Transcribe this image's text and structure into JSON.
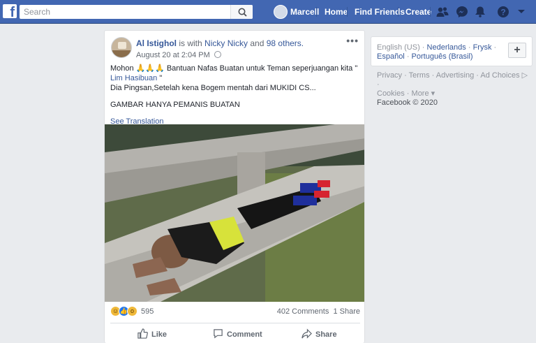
{
  "topbar": {
    "logo": "f",
    "search_placeholder": "Search",
    "user_name": "Marcell",
    "links": [
      "Home",
      "Find Friends",
      "Create"
    ],
    "icons": [
      "friends-icon",
      "messenger-icon",
      "notifications-icon",
      "help-icon",
      "account-menu-icon"
    ],
    "accent": "#4267b2"
  },
  "post": {
    "author": "Al Istighol",
    "with_text": "is with",
    "tagged": "Nicky Nicky",
    "and_text": "and",
    "others": "98 others.",
    "timestamp": "August 20 at 2:04 PM",
    "menu": "•••",
    "line1": "Mohon 🙏🙏🙏 Bantuan Nafas Buatan untuk Teman seperjuangan kita \"",
    "mention": "Lim Hasibuan",
    "mention_close": " \"",
    "line3": "Dia Pingsan,Setelah kena Bogem mentah dari MUKIDI CS...",
    "line4": "GAMBAR HANYA PEMANIS BUATAN",
    "see_translation": "See Translation",
    "reaction_count": "595",
    "comments": "402 Comments",
    "shares": "1 Share",
    "actions": {
      "like": "Like",
      "comment": "Comment",
      "share": "Share"
    }
  },
  "sidebar": {
    "languages": [
      "English (US)",
      "Nederlands",
      "Frysk",
      "Español",
      "Português (Brasil)"
    ],
    "add_language": "+",
    "footer": [
      "Privacy",
      "Terms",
      "Advertising",
      "Ad Choices",
      "Cookies",
      "More"
    ],
    "copyright": "Facebook © 2020"
  }
}
